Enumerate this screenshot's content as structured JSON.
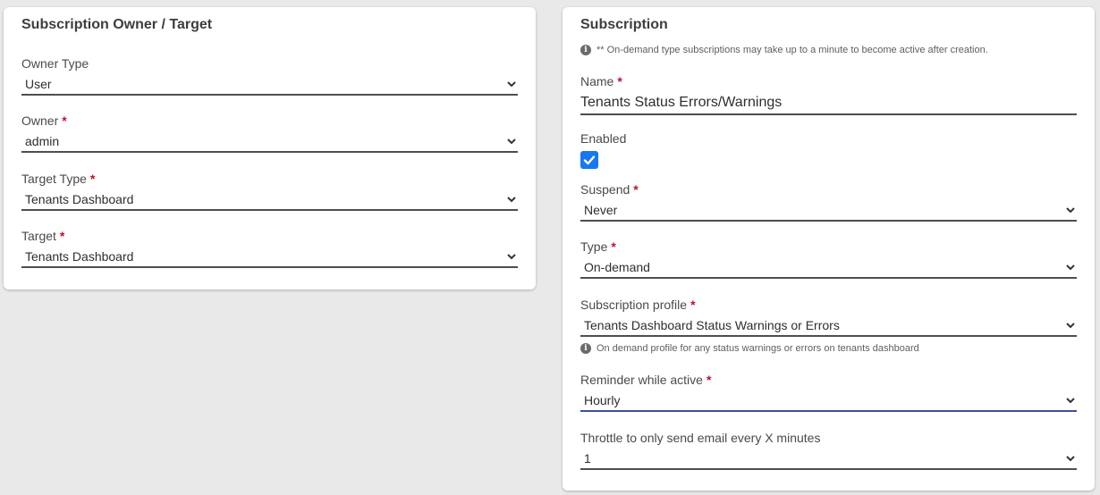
{
  "owner_panel": {
    "title": "Subscription Owner / Target",
    "owner_type": {
      "label": "Owner Type",
      "required": false,
      "value": "User"
    },
    "owner": {
      "label": "Owner",
      "required": true,
      "value": "admin"
    },
    "target_type": {
      "label": "Target Type",
      "required": true,
      "value": "Tenants Dashboard"
    },
    "target": {
      "label": "Target",
      "required": true,
      "value": "Tenants Dashboard"
    }
  },
  "subscription_panel": {
    "title": "Subscription",
    "note": "** On-demand type subscriptions may take up to a minute to become active after creation.",
    "name": {
      "label": "Name",
      "required": true,
      "value": "Tenants Status Errors/Warnings"
    },
    "enabled": {
      "label": "Enabled",
      "checked": true
    },
    "suspend": {
      "label": "Suspend",
      "required": true,
      "value": "Never"
    },
    "type": {
      "label": "Type",
      "required": true,
      "value": "On-demand"
    },
    "profile": {
      "label": "Subscription profile",
      "required": true,
      "value": "Tenants Dashboard Status Warnings or Errors",
      "hint": "On demand profile for any status warnings or errors on tenants dashboard"
    },
    "reminder": {
      "label": "Reminder while active",
      "required": true,
      "value": "Hourly"
    },
    "throttle": {
      "label": "Throttle to only send email every X minutes",
      "required": false,
      "value": "1"
    }
  },
  "required_marker": "*",
  "info_glyph": "i",
  "icons": {
    "dropdown": "chevron-down-icon",
    "info": "info-icon",
    "check": "check-icon"
  },
  "colors": {
    "background": "#e9e9e9",
    "card": "#ffffff",
    "required": "#c0102a",
    "checkbox": "#1877f2",
    "active_underline": "#3e4f9a"
  }
}
